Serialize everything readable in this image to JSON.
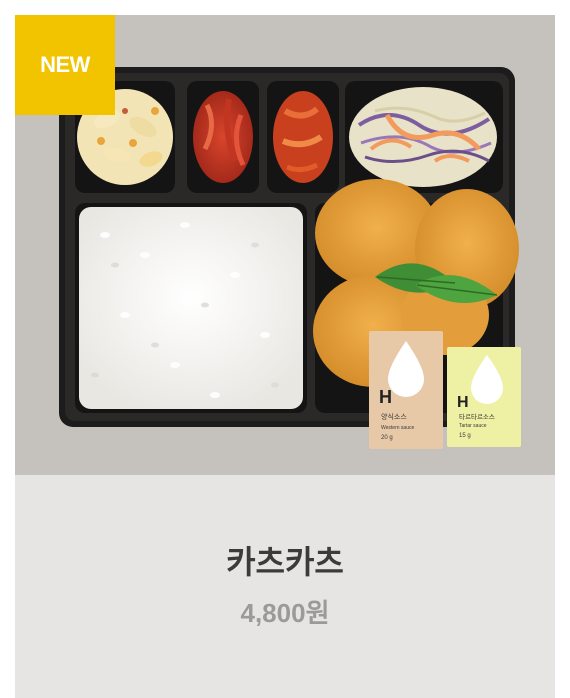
{
  "product": {
    "badge": "NEW",
    "name": "카츠카츠",
    "price": "4,800원",
    "image_alt": "카츠카츠 도시락"
  },
  "sauce_packets": [
    {
      "label": "양식소스",
      "sublabel": "Western sauce",
      "weight": "20 g"
    },
    {
      "label": "타르타르소스",
      "sublabel": "Tartar sauce",
      "weight": "15 g"
    }
  ],
  "colors": {
    "badge_bg": "#f2c400",
    "photo_bg": "#c5c2bd",
    "card_bg": "#e6e5e3",
    "name_text": "#3b3b3b",
    "price_text": "#9a9a9a"
  }
}
